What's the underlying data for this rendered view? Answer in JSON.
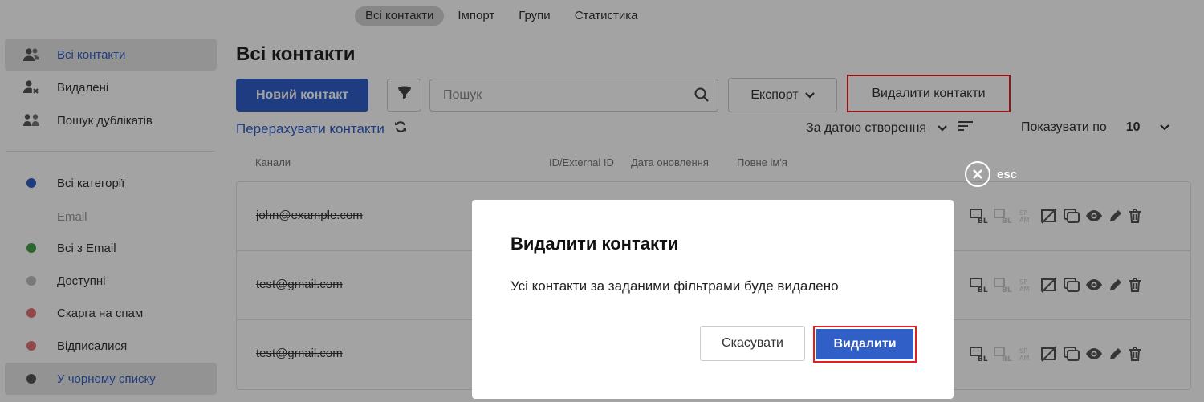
{
  "top_nav": {
    "tabs": [
      {
        "label": "Всі контакти",
        "active": true
      },
      {
        "label": "Імпорт"
      },
      {
        "label": "Групи"
      },
      {
        "label": "Статистика"
      }
    ]
  },
  "sidebar": {
    "items": [
      {
        "label": "Всі контакти",
        "icon": "users-icon",
        "active": true
      },
      {
        "label": "Видалені",
        "icon": "user-remove-icon"
      },
      {
        "label": "Пошук дублікатів",
        "icon": "duplicates-icon"
      }
    ],
    "section_heading": "Email",
    "categories": [
      {
        "label": "Всі категорії",
        "color": "#2f5fc7"
      },
      {
        "label": "Всі з Email",
        "color": "#43a047"
      },
      {
        "label": "Доступні",
        "color": "#bdbdbd"
      },
      {
        "label": "Скарга на спам",
        "color": "#e57373"
      },
      {
        "label": "Відписалися",
        "color": "#e57373"
      },
      {
        "label": "У чорному списку",
        "color": "#555555",
        "active": true
      }
    ]
  },
  "main": {
    "title": "Всі контакти",
    "new_contact_label": "Новий контакт",
    "search_placeholder": "Пошук",
    "export_label": "Експорт",
    "delete_contacts_label": "Видалити контакти",
    "recalc_label": "Перерахувати контакти",
    "sort_label": "За датою створення",
    "show_per_page_label": "Показувати по",
    "per_page_value": "10"
  },
  "table": {
    "columns": [
      "Канали",
      "ID/External ID",
      "Дата оновлення",
      "Повне ім'я"
    ],
    "rows": [
      {
        "email": "john@example.com"
      },
      {
        "email": "test@gmail.com"
      },
      {
        "email": "test@gmail.com"
      }
    ],
    "row_action_icons": [
      "blacklist-icon",
      "blacklist-disabled-icon",
      "spam-disabled-icon",
      "no-image-icon",
      "copy-icon",
      "eye-icon",
      "pencil-icon",
      "trash-icon"
    ]
  },
  "modal": {
    "esc_label": "esc",
    "title": "Видалити контакти",
    "body": "Усі контакти за заданими фільтрами буде видалено",
    "cancel_label": "Скасувати",
    "confirm_label": "Видалити"
  },
  "colors": {
    "primary": "#2f5fc7",
    "highlight": "#e02020"
  }
}
